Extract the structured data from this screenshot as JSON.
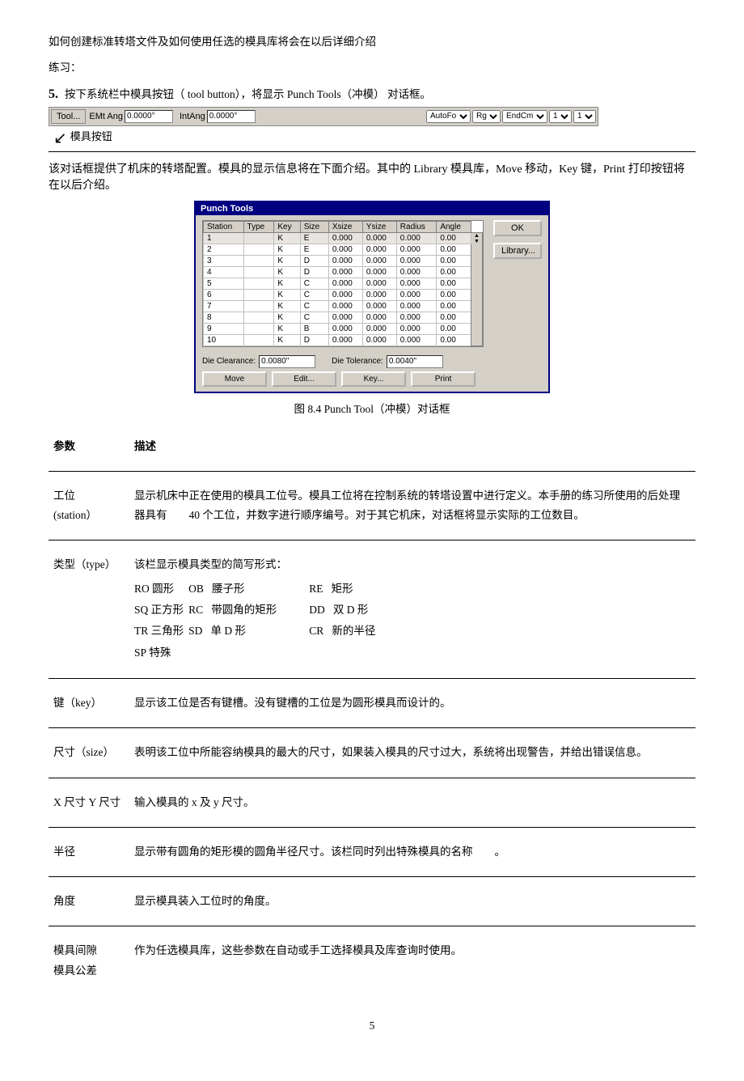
{
  "intro": {
    "line1": "如何创建标准转塔文件及如何使用任选的模具库将会在以后详细介绍",
    "line2": "练习："
  },
  "step5": {
    "number": "5.",
    "text_before": "按下系统栏中模具按钮（",
    "tool_button": "tool button",
    "text_after": "），将显示  Punch  Tools（冲模）  对话框。"
  },
  "toolbar": {
    "tool_btn": "Tool...",
    "emt_label": "EMt Ang",
    "emt_value": "0.0000°",
    "intang_label": "IntAng",
    "intang_value": "0.0000°",
    "autof_label": "AutoFo",
    "rg_label": "Rg",
    "endcm_label": "EndCm",
    "num1": "1",
    "num2": "1"
  },
  "toolbar_annotation": "模具按钮",
  "section_desc": "该对话框提供了机床的转塔配置。模具的显示信息将在下面介绍。其中的        Library  模具库，Move 移动，Key 键，Print 打印按钮将在以后介绍。",
  "dialog": {
    "title": "Punch Tools",
    "table": {
      "headers": [
        "Station",
        "Type",
        "Key",
        "Size",
        "Xsize",
        "Ysize",
        "Radius",
        "Angle"
      ],
      "rows": [
        [
          "1",
          "",
          "K",
          "E",
          "0.000",
          "0.000",
          "0.000",
          "0.00"
        ],
        [
          "2",
          "",
          "K",
          "E",
          "0.000",
          "0.000",
          "0.000",
          "0.00"
        ],
        [
          "3",
          "",
          "K",
          "D",
          "0.000",
          "0.000",
          "0.000",
          "0.00"
        ],
        [
          "4",
          "",
          "K",
          "D",
          "0.000",
          "0.000",
          "0.000",
          "0.00"
        ],
        [
          "5",
          "",
          "K",
          "C",
          "0.000",
          "0.000",
          "0.000",
          "0.00"
        ],
        [
          "6",
          "",
          "K",
          "C",
          "0.000",
          "0.000",
          "0.000",
          "0.00"
        ],
        [
          "7",
          "",
          "K",
          "C",
          "0.000",
          "0.000",
          "0.000",
          "0.00"
        ],
        [
          "8",
          "",
          "K",
          "C",
          "0.000",
          "0.000",
          "0.000",
          "0.00"
        ],
        [
          "9",
          "",
          "K",
          "B",
          "0.000",
          "0.000",
          "0.000",
          "0.00"
        ],
        [
          "10",
          "",
          "K",
          "D",
          "0.000",
          "0.000",
          "0.000",
          "0.00"
        ]
      ]
    },
    "ok_btn": "OK",
    "library_btn": "Library...",
    "die_clearance_label": "Die Clearance:",
    "die_clearance_value": "0.0080\"",
    "die_tolerance_label": "Die Tolerance:",
    "die_tolerance_value": "0.0040\"",
    "move_btn": "Move",
    "edit_btn": "Edit...",
    "key_btn": "Key...",
    "print_btn": "Print"
  },
  "fig_caption": "图 8.4    Punch  Tool（冲模）对话框",
  "params": [
    {
      "name": "参数",
      "desc": "描述"
    },
    {
      "name": "工位\n(station）",
      "desc": "显示机床中正在使用的模具工位号。模具工位将在控制系统的转塔设置中进行定义。本手册的练习所使用的后处理器具有        40 个工位，并数字进行顺序编号。对于其它机床，对话框将显示实际的工位数目。"
    },
    {
      "name": "类型（type）",
      "desc_prefix": "该栏显示模具类型的简写形式：",
      "type_items": [
        {
          "code": "RO",
          "text": "圆形"
        },
        {
          "code": "OB",
          "text": "腰子形"
        },
        {
          "code": "RE",
          "text": "矩形"
        },
        {
          "code": "SQ",
          "text": "正方形"
        },
        {
          "code": "RC",
          "text": "带圆角的矩形"
        },
        {
          "code": "DD",
          "text": "双 D 形"
        },
        {
          "code": "TR",
          "text": "三角形"
        },
        {
          "code": "SD",
          "text": "单 D 形"
        },
        {
          "code": "CR",
          "text": "新的半径"
        },
        {
          "code": "SP",
          "text": "特殊"
        }
      ]
    },
    {
      "name": "键（key）",
      "desc": "显示该工位是否有键槽。没有键槽的工位是为圆形模具而设计的。"
    },
    {
      "name": "尺寸（size）",
      "desc": "表明该工位中所能容纳模具的最大的尺寸，如果装入模具的尺寸过大，系统将出现警告，并给出错误信息。"
    },
    {
      "name": "X 尺寸  Y 尺寸",
      "desc": "输入模具的  x  及 y 尺寸。"
    },
    {
      "name": "半径",
      "desc": "显示带有圆角的矩形模的圆角半径尺寸。该栏同时列出特殊模具的名称        。"
    },
    {
      "name": "角度",
      "desc": "显示模具装入工位时的角度。"
    },
    {
      "name": "模具间隙\n模具公差",
      "desc": "作为任选模具库，这些参数在自动或手工选择模具及库查询时使用。"
    }
  ],
  "page_number": "5"
}
